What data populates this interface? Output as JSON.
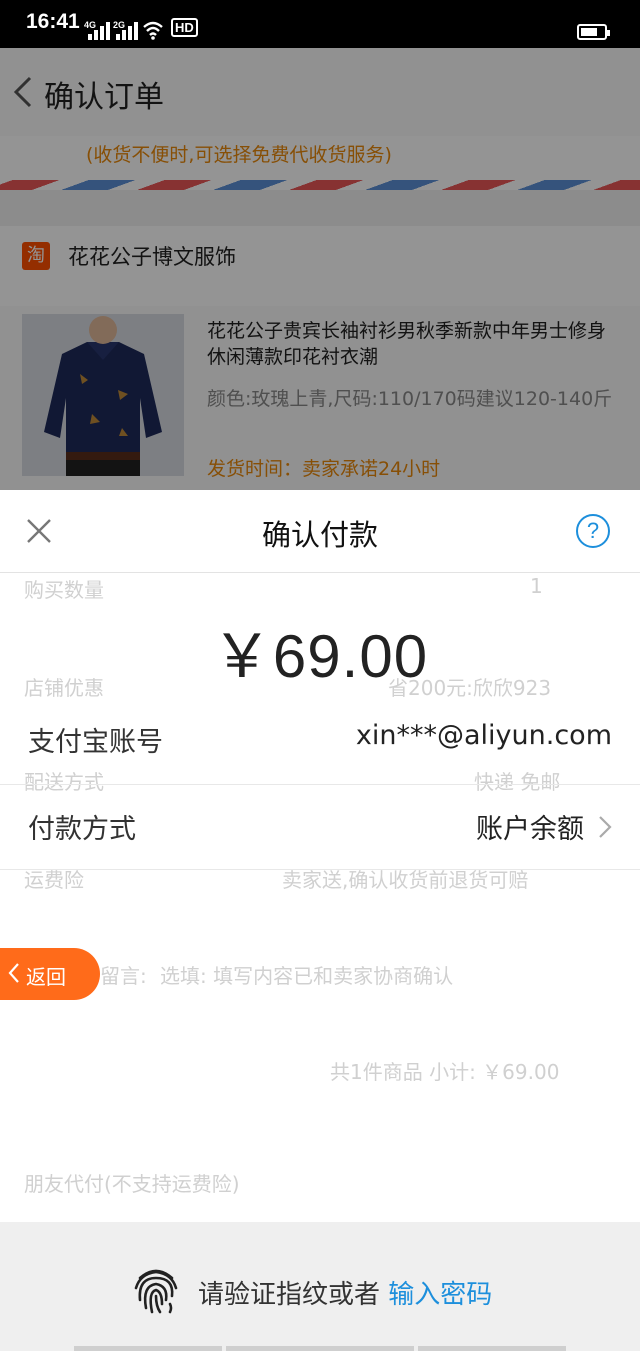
{
  "status_bar": {
    "time": "16:41",
    "signal1": "4G",
    "signal2": "2G",
    "hd_badge": "HD"
  },
  "background_page": {
    "title": "确认订单",
    "address_note": "(收货不便时,可选择免费代收货服务)",
    "shop_name": "花花公子博文服饰",
    "shop_logo": "淘",
    "product": {
      "title": "花花公子贵宾长袖衬衫男秋季新款中年男士修身休闲薄款印花衬衣潮",
      "sku": "颜色:玫瑰上青,尺码:110/170码建议120-140斤",
      "ship_time": "发货时间：卖家承诺24小时"
    },
    "rows": {
      "quantity_label": "购买数量",
      "quantity_value": "1",
      "discount_label": "店铺优惠",
      "discount_value": "省200元:欣欣923",
      "delivery_label": "配送方式",
      "delivery_value": "快递 免邮",
      "insurance_label": "运费险",
      "insurance_value": "卖家送,确认收货前退货可赔",
      "message_label": "留言:",
      "message_placeholder": "选填: 填写内容已和卖家协商确认",
      "subtotal": "共1件商品   小计: ￥69.00",
      "friend_pay": "朋友代付(不支持运费险)"
    }
  },
  "payment_sheet": {
    "title": "确认付款",
    "help_symbol": "?",
    "amount": "￥69.00",
    "account_label": "支付宝账号",
    "account_value": "xin***@aliyun.com",
    "method_label": "付款方式",
    "method_value": "账户余额"
  },
  "return_button": {
    "label": "返回"
  },
  "fingerprint": {
    "prompt": "请验证指纹或者",
    "link": "输入密码"
  },
  "colors": {
    "accent_blue": "#1d8fdc",
    "orange": "#ff6b1a",
    "warning_text": "#e8890c"
  }
}
